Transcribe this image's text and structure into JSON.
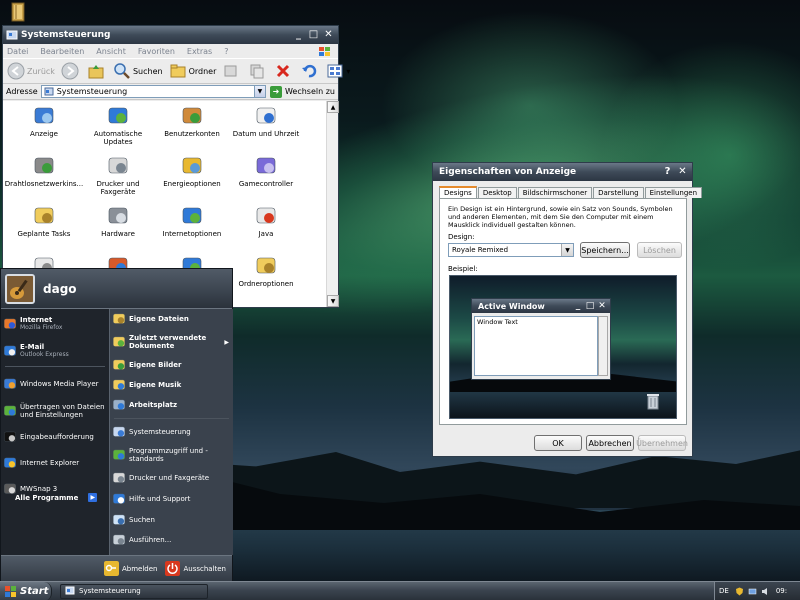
{
  "control_panel": {
    "title": "Systemsteuerung",
    "menu": [
      "Datei",
      "Bearbeiten",
      "Ansicht",
      "Favoriten",
      "Extras",
      "?"
    ],
    "toolbar": {
      "back": "Zurück",
      "search": "Suchen",
      "folders": "Ordner"
    },
    "address": {
      "label": "Adresse",
      "value": "Systemsteuerung",
      "go": "Wechseln zu"
    },
    "items": [
      {
        "label": "Anzeige",
        "icon": "display-icon"
      },
      {
        "label": "Automatische Updates",
        "icon": "windows-update-icon"
      },
      {
        "label": "Benutzerkonten",
        "icon": "users-icon"
      },
      {
        "label": "Datum und Uhrzeit",
        "icon": "clock-icon"
      },
      {
        "label": "Drahtlosnetzwerkins...",
        "icon": "wireless-icon"
      },
      {
        "label": "Drucker und Faxgeräte",
        "icon": "printer-icon"
      },
      {
        "label": "Energieoptionen",
        "icon": "power-icon"
      },
      {
        "label": "Gamecontroller",
        "icon": "gamepad-icon"
      },
      {
        "label": "Geplante Tasks",
        "icon": "scheduled-tasks-icon"
      },
      {
        "label": "Hardware",
        "icon": "hardware-icon"
      },
      {
        "label": "Internetoptionen",
        "icon": "globe-icon"
      },
      {
        "label": "Java",
        "icon": "java-icon"
      },
      {
        "label": "",
        "icon": "mouse-icon"
      },
      {
        "label": "",
        "icon": "network-icon"
      },
      {
        "label": "",
        "icon": "globe-icon"
      },
      {
        "label": "Ordneroptionen",
        "icon": "folder-options-icon"
      }
    ]
  },
  "start_menu": {
    "user": "dago",
    "left": [
      {
        "title": "Internet",
        "subtitle": "Mozilla Firefox",
        "icon": "firefox-icon",
        "bold": true
      },
      {
        "title": "E-Mail",
        "subtitle": "Outlook Express",
        "icon": "mail-icon",
        "bold": true
      },
      {
        "title": "Windows Media Player",
        "subtitle": "",
        "icon": "media-player-icon",
        "bold": false
      },
      {
        "title": "Übertragen von Dateien und Einstellungen",
        "subtitle": "",
        "icon": "transfer-icon",
        "bold": false
      },
      {
        "title": "Eingabeaufforderung",
        "subtitle": "",
        "icon": "cmd-icon",
        "bold": false
      },
      {
        "title": "Internet Explorer",
        "subtitle": "",
        "icon": "ie-icon",
        "bold": false
      },
      {
        "title": "MWSnap 3",
        "subtitle": "",
        "icon": "mwsnap-icon",
        "bold": false
      }
    ],
    "all_programs": "Alle Programme",
    "right_top": [
      {
        "title": "Eigene Dateien",
        "icon": "documents-icon"
      },
      {
        "title": "Zuletzt verwendete Dokumente",
        "icon": "recent-documents-icon",
        "arrow": true
      },
      {
        "title": "Eigene Bilder",
        "icon": "pictures-icon"
      },
      {
        "title": "Eigene Musik",
        "icon": "music-icon"
      },
      {
        "title": "Arbeitsplatz",
        "icon": "computer-icon"
      }
    ],
    "right_bottom": [
      {
        "title": "Systemsteuerung",
        "icon": "control-panel-icon"
      },
      {
        "title": "Programmzugriff und -standards",
        "icon": "program-access-icon"
      },
      {
        "title": "Drucker und Faxgeräte",
        "icon": "printer-icon"
      },
      {
        "title": "Hilfe und Support",
        "icon": "help-icon"
      },
      {
        "title": "Suchen",
        "icon": "search-icon"
      },
      {
        "title": "Ausführen...",
        "icon": "run-icon"
      }
    ],
    "logoff": "Abmelden",
    "shutdown": "Ausschalten"
  },
  "display_dialog": {
    "title": "Eigenschaften von Anzeige",
    "tabs": [
      "Designs",
      "Desktop",
      "Bildschirmschoner",
      "Darstellung",
      "Einstellungen"
    ],
    "active_tab": "Designs",
    "description": "Ein Design ist ein Hintergrund, sowie ein Satz von Sounds, Symbolen und anderen Elementen, mit dem Sie den Computer mit einem Mausklick individuell gestalten können.",
    "design_label": "Design:",
    "design_value": "Royale Remixed",
    "save": "Speichern...",
    "delete": "Löschen",
    "example_label": "Beispiel:",
    "preview_window_title": "Active Window",
    "preview_window_text": "Window Text",
    "ok": "OK",
    "cancel": "Abbrechen",
    "apply": "Übernehmen"
  },
  "taskbar": {
    "start": "Start",
    "task": "Systemsteuerung",
    "lang": "DE",
    "clock": "09:"
  },
  "colors": {
    "accent_tab": "#e68b2c",
    "titlebar": "#3e4a58",
    "start_menu": "#2c333d"
  }
}
